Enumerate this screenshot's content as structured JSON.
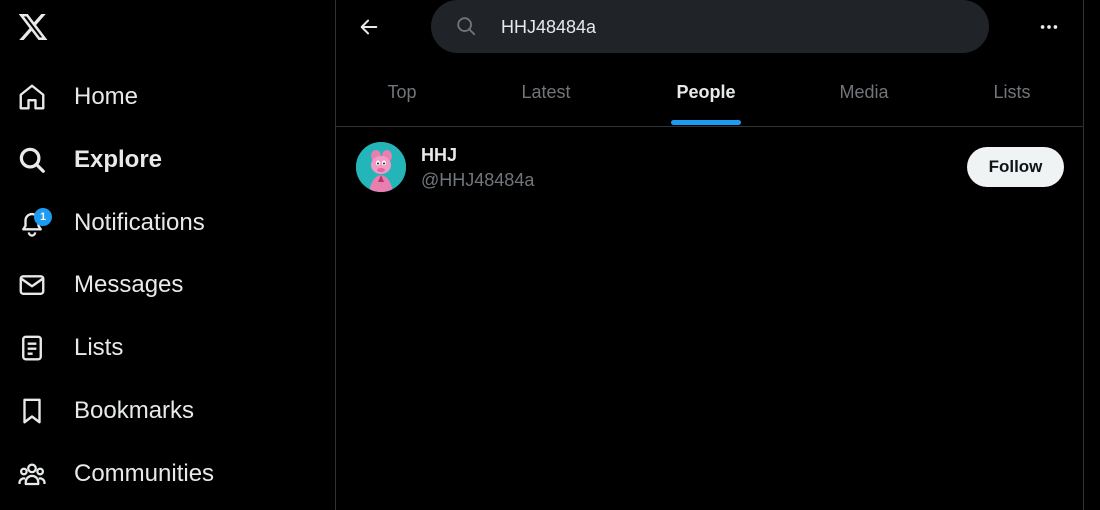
{
  "colors": {
    "background": "#000000",
    "text_primary": "#e7e9ea",
    "text_secondary": "#71767b",
    "accent": "#1d9bf0",
    "search_bg": "#202327",
    "follow_bg": "#eff3f4",
    "divider": "#2f3336"
  },
  "logo": {
    "icon": "x-logo-icon"
  },
  "sidebar": {
    "items": [
      {
        "label": "Home",
        "icon": "home-icon"
      },
      {
        "label": "Explore",
        "icon": "search-icon"
      },
      {
        "label": "Notifications",
        "icon": "bell-icon",
        "badge": "1"
      },
      {
        "label": "Messages",
        "icon": "envelope-icon"
      },
      {
        "label": "Lists",
        "icon": "list-icon"
      },
      {
        "label": "Bookmarks",
        "icon": "bookmark-icon"
      },
      {
        "label": "Communities",
        "icon": "people-icon"
      }
    ]
  },
  "header": {
    "back_icon": "arrow-left-icon",
    "search": {
      "value": "HHJ48484a",
      "icon": "search-icon"
    },
    "more_icon": "more-horizontal-icon"
  },
  "tabs": [
    {
      "label": "Top"
    },
    {
      "label": "Latest"
    },
    {
      "label": "People",
      "active": true
    },
    {
      "label": "Media"
    },
    {
      "label": "Lists"
    }
  ],
  "results": [
    {
      "name": "HHJ",
      "handle": "@HHJ48484a",
      "follow_label": "Follow"
    }
  ]
}
